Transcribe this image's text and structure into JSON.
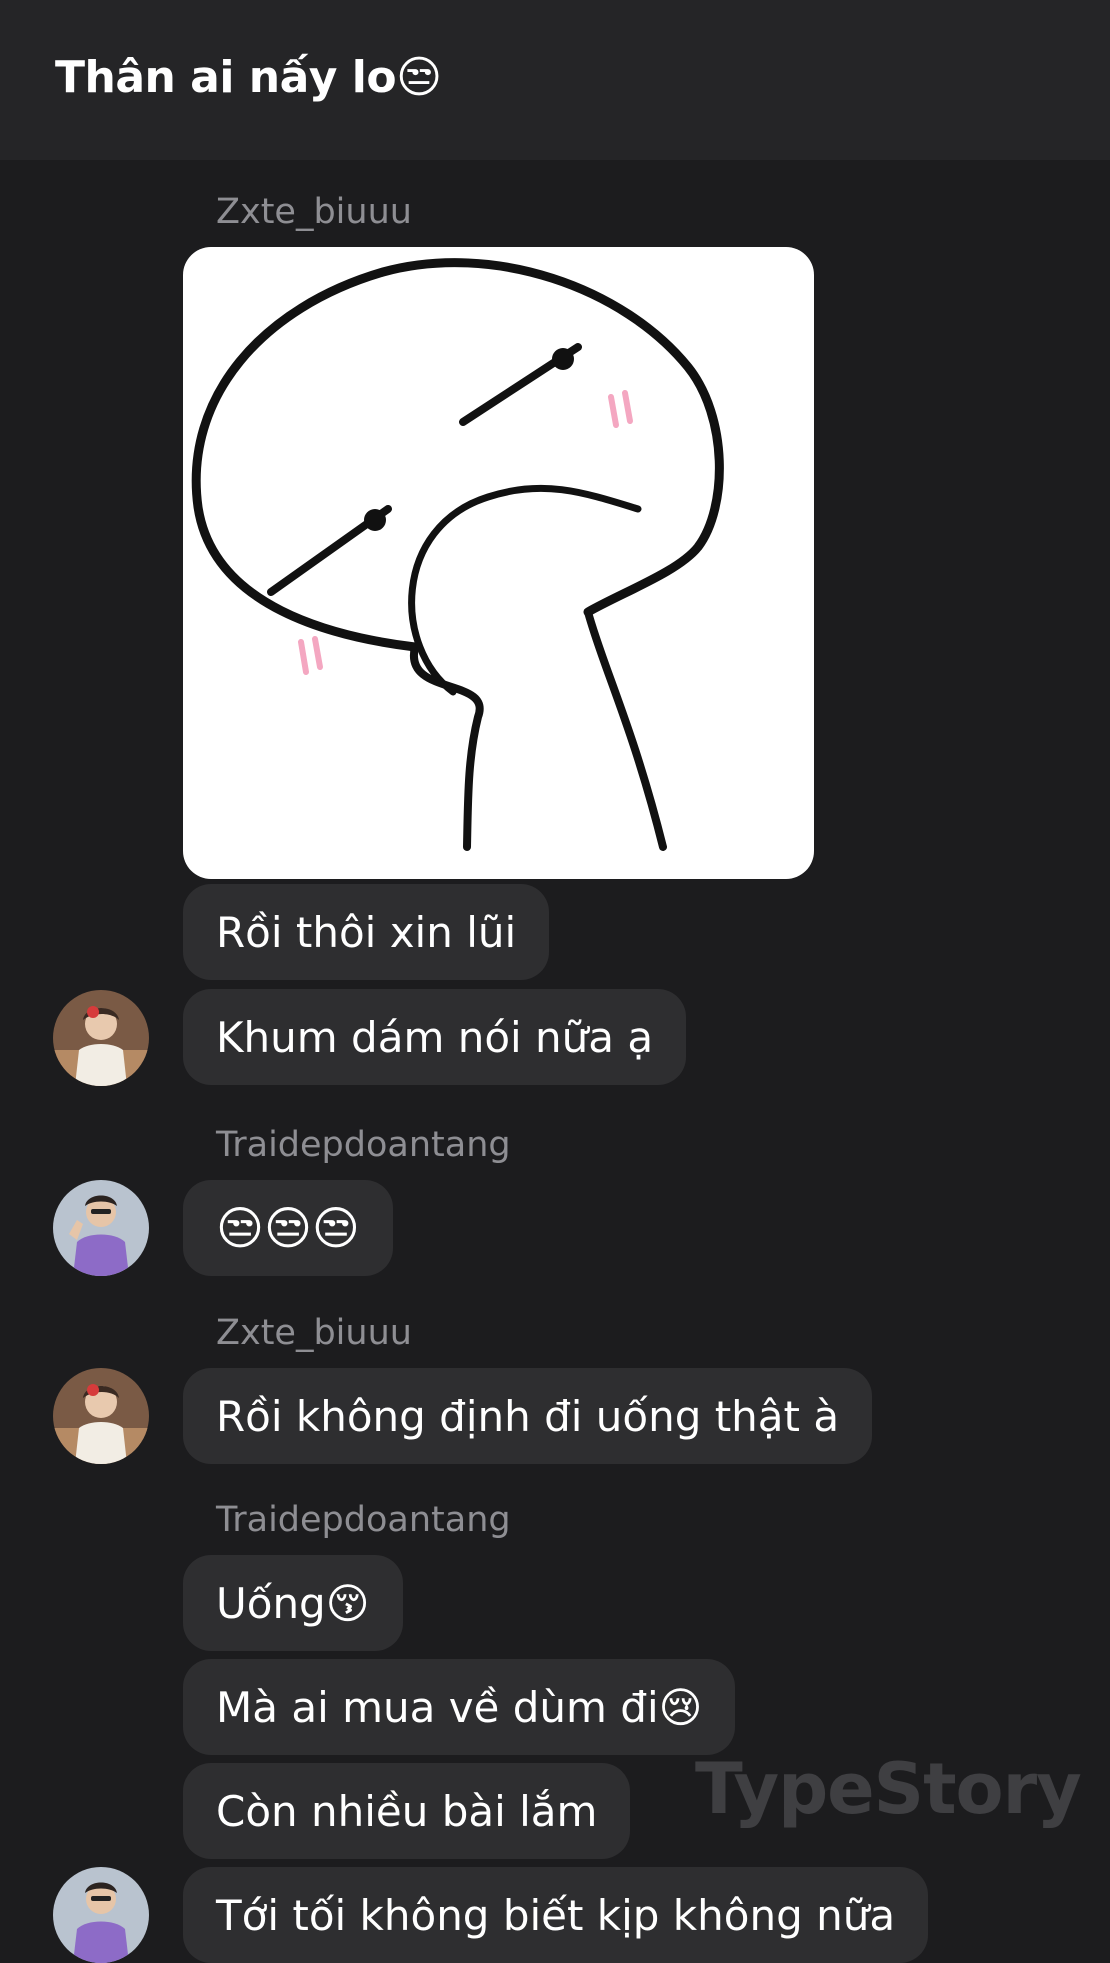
{
  "conversation": {
    "title": "Thân ai nấy lo😒"
  },
  "messages": [
    {
      "sender": "Zxte_biuuu"
    },
    {
      "text": "Rồi thôi xin lũi"
    },
    {
      "text": "Khum dám nói nữa ạ"
    },
    {
      "sender": "Traidepdoantang"
    },
    {
      "text": "😒😒😒"
    },
    {
      "sender": "Zxte_biuuu"
    },
    {
      "text": "Rồi không định đi uống thật à"
    },
    {
      "sender": "Traidepdoantang"
    },
    {
      "text": "Uống😚"
    },
    {
      "text": "Mà ai mua về dùm đi😢"
    },
    {
      "text": "Còn nhiều bài lắm"
    },
    {
      "text": "Tới tối không biết kịp không nữa"
    }
  ],
  "watermark": "TypeStory",
  "icons": {
    "sticker": "smug-face-sticker",
    "avatar_1": "avatar-zxte-biuuu",
    "avatar_2": "avatar-traidepdoantang"
  }
}
